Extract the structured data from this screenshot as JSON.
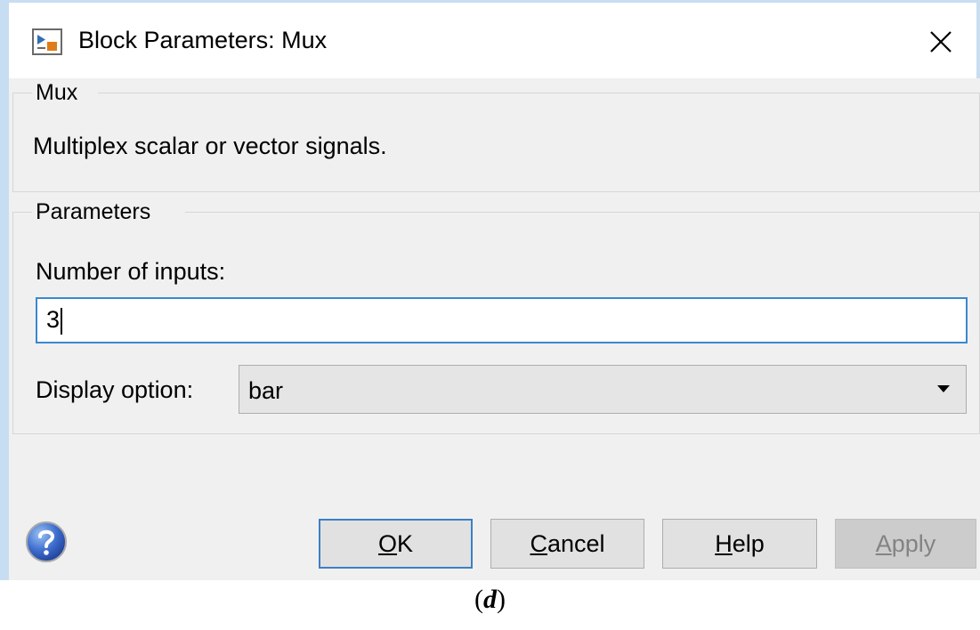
{
  "window": {
    "title": "Block Parameters: Mux",
    "title_icon": "simulink-block-icon",
    "close_icon": "close-x-icon"
  },
  "block": {
    "name": "Mux",
    "description": "Multiplex scalar or vector signals."
  },
  "parameters": {
    "group_label": "Parameters",
    "num_inputs_label": "Number of inputs:",
    "num_inputs_value": "3",
    "display_option_label": "Display option:",
    "display_option_value": "bar"
  },
  "buttons": {
    "ok": "OK",
    "cancel": "Cancel",
    "help": "Help",
    "apply": "Apply",
    "help_icon": "question-mark-icon"
  },
  "colors": {
    "accent": "#3b88cf",
    "dialog_bg": "#f0f0f0",
    "apply_disabled_text": "#838383"
  },
  "caption": {
    "open": "(",
    "letter": "d",
    "close": ")"
  }
}
